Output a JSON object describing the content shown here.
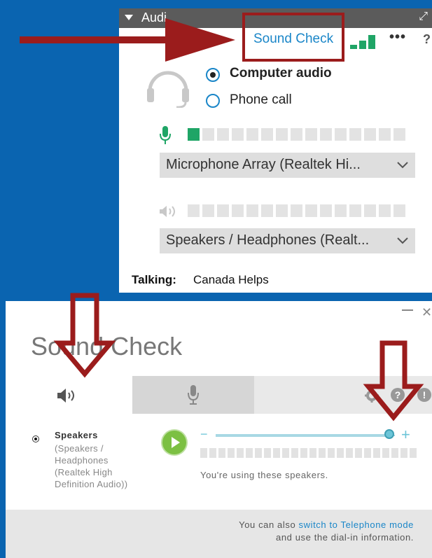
{
  "audio_panel": {
    "header_title": "Audi",
    "sound_check_link": "Sound Check",
    "more_icon": "more-icon",
    "help_icon": "?",
    "audio_options": [
      {
        "label": "Computer audio",
        "selected": true
      },
      {
        "label": "Phone call",
        "selected": false
      }
    ],
    "mic_level_on_segments": 1,
    "mic_level_total_segments": 15,
    "microphone_device": "Microphone Array (Realtek Hi...",
    "speaker_level_total_segments": 15,
    "speaker_device": "Speakers / Headphones (Realt...",
    "talking_label": "Talking:",
    "talking_value": "Canada Helps"
  },
  "sound_check_dialog": {
    "title": "Sound Check",
    "tabs": [
      {
        "name": "speakers",
        "icon": "speaker-icon",
        "active": true
      },
      {
        "name": "microphone",
        "icon": "microphone-icon",
        "active": false
      }
    ],
    "settings_icon": "gear-icon",
    "help_icon_label": "?",
    "info_icon_label": "!",
    "speaker_name": "Speakers",
    "speaker_description": "(Speakers / Headphones (Realtek High Definition Audio))",
    "volume_minus": "−",
    "volume_plus": "+",
    "volume_level": 0.97,
    "status_text": "You're using these speakers.",
    "footer_prefix": "You can also ",
    "footer_link": "switch to Telephone mode",
    "footer_line2": "and use the dial-in information."
  },
  "colors": {
    "background": "#0a64b0",
    "accent_blue": "#1a86c8",
    "level_green": "#1fa566",
    "annotation_red": "#9b1c1c",
    "play_green": "#7cc043",
    "slider_teal": "#6cc5d8"
  }
}
